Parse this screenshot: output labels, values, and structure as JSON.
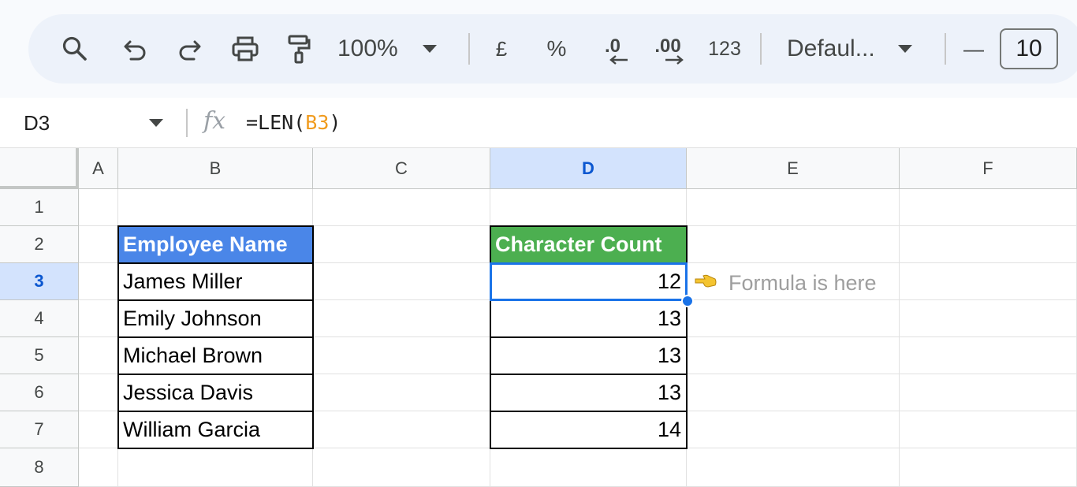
{
  "toolbar": {
    "zoom": "100%",
    "currency_label": "£",
    "percent_label": "%",
    "decrease_decimal_label": ".0",
    "increase_decimal_label": ".00",
    "more_formats_label": "123",
    "font_name": "Defaul...",
    "font_size": "10",
    "minus_label": "—"
  },
  "formula_bar": {
    "name_box": "D3",
    "fx_label": "fx",
    "formula_prefix": "=LEN(",
    "formula_ref": "B3",
    "formula_suffix": ")",
    "ref_color": "#f09b1e"
  },
  "sheet": {
    "columns": [
      "A",
      "B",
      "C",
      "D",
      "E",
      "F"
    ],
    "active_column": "D",
    "rows": [
      "1",
      "2",
      "3",
      "4",
      "5",
      "6",
      "7",
      "8"
    ],
    "active_row": "3",
    "name_header": "Employee Name",
    "count_header": "Character Count",
    "name_header_color": "#4a86e8",
    "count_header_color": "#4caf50",
    "selection_color": "#1a73e8",
    "employees": [
      {
        "name": "James Miller",
        "count": "12"
      },
      {
        "name": "Emily Johnson",
        "count": "13"
      },
      {
        "name": "Michael Brown",
        "count": "13"
      },
      {
        "name": "Jessica Davis",
        "count": "13"
      },
      {
        "name": "William Garcia",
        "count": "14"
      }
    ],
    "note_icon": "pointing-left-hand-icon",
    "note_text": "Formula is here"
  }
}
